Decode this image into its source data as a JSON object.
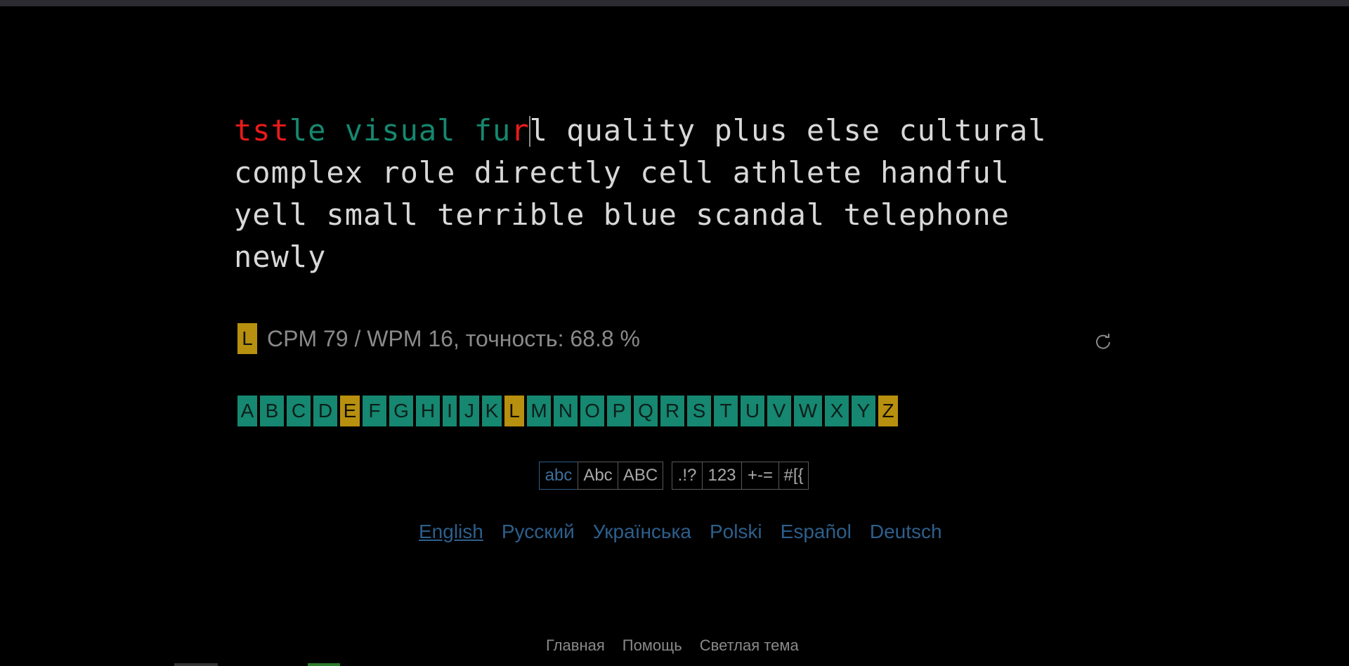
{
  "typing": {
    "line1": [
      {
        "t": "tst",
        "c": "err"
      },
      {
        "t": "le visual ",
        "c": "ok"
      },
      {
        "t": "fu",
        "c": "ok"
      },
      {
        "t": "r",
        "c": "err"
      },
      {
        "t": "|",
        "c": "cursor"
      },
      {
        "t": "l quality plus else cultural",
        "c": "pending"
      }
    ],
    "line2": "complex role directly cell athlete handful",
    "line3": "yell small terrible blue scandal telephone",
    "line4": "newly"
  },
  "stats": {
    "badge": "L",
    "text": "CPM 79 / WPM 16, точность: 68.8 %"
  },
  "letters": [
    {
      "l": "A",
      "w": 28,
      "hl": false
    },
    {
      "l": "B",
      "w": 34,
      "hl": false
    },
    {
      "l": "C",
      "w": 34,
      "hl": false
    },
    {
      "l": "D",
      "w": 34,
      "hl": false
    },
    {
      "l": "E",
      "w": 28,
      "hl": true
    },
    {
      "l": "F",
      "w": 34,
      "hl": false
    },
    {
      "l": "G",
      "w": 34,
      "hl": false
    },
    {
      "l": "H",
      "w": 34,
      "hl": false
    },
    {
      "l": "I",
      "w": 20,
      "hl": false
    },
    {
      "l": "J",
      "w": 28,
      "hl": false
    },
    {
      "l": "K",
      "w": 28,
      "hl": false
    },
    {
      "l": "L",
      "w": 28,
      "hl": true
    },
    {
      "l": "M",
      "w": 34,
      "hl": false
    },
    {
      "l": "N",
      "w": 34,
      "hl": false
    },
    {
      "l": "O",
      "w": 34,
      "hl": false
    },
    {
      "l": "P",
      "w": 34,
      "hl": false
    },
    {
      "l": "Q",
      "w": 34,
      "hl": false
    },
    {
      "l": "R",
      "w": 34,
      "hl": false
    },
    {
      "l": "S",
      "w": 34,
      "hl": false
    },
    {
      "l": "T",
      "w": 34,
      "hl": false
    },
    {
      "l": "U",
      "w": 34,
      "hl": false
    },
    {
      "l": "V",
      "w": 34,
      "hl": false
    },
    {
      "l": "W",
      "w": 40,
      "hl": false
    },
    {
      "l": "X",
      "w": 34,
      "hl": false
    },
    {
      "l": "Y",
      "w": 34,
      "hl": false
    },
    {
      "l": "Z",
      "w": 28,
      "hl": true
    }
  ],
  "filters": {
    "case": [
      {
        "label": "abc",
        "w": 56,
        "selected": true
      },
      {
        "label": "Abc",
        "w": 58,
        "selected": false
      },
      {
        "label": "ABC",
        "w": 65,
        "selected": false
      }
    ],
    "extras": [
      {
        "label": ".!?",
        "w": 44,
        "selected": false
      },
      {
        "label": "123",
        "w": 57,
        "selected": false
      },
      {
        "label": "+-=",
        "w": 54,
        "selected": false
      },
      {
        "label": "#[{",
        "w": 43,
        "selected": false
      }
    ]
  },
  "languages": [
    {
      "label": "English",
      "active": true
    },
    {
      "label": "Русский",
      "active": false
    },
    {
      "label": "Українська",
      "active": false
    },
    {
      "label": "Polski",
      "active": false
    },
    {
      "label": "Español",
      "active": false
    },
    {
      "label": "Deutsch",
      "active": false
    }
  ],
  "footer": [
    "Главная",
    "Помощь",
    "Светлая тема"
  ],
  "colors": {
    "error": "#ea1a1a",
    "correct": "#16876f",
    "pending": "#d8d8d8",
    "letter_bg": "#168770",
    "letter_highlight": "#b8900f",
    "link": "#2d5f8c"
  },
  "icons": {
    "reload": "reload-icon"
  }
}
